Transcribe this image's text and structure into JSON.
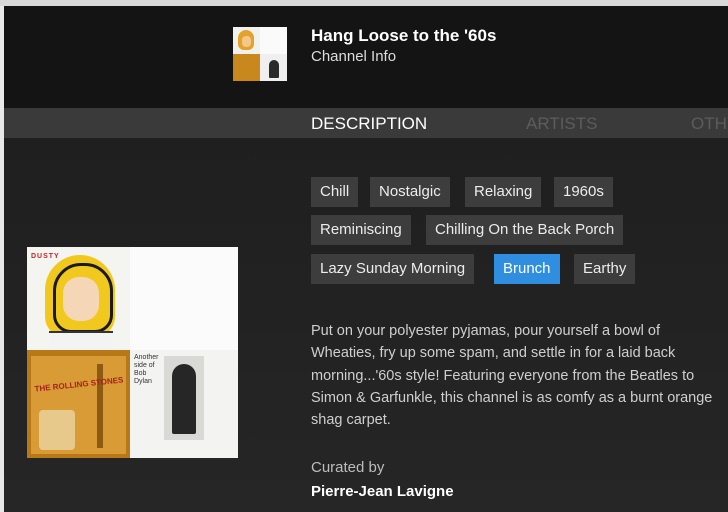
{
  "header": {
    "title": "Hang Loose to the '60s",
    "subtitle": "Channel Info"
  },
  "tabs": [
    {
      "label": "DESCRIPTION",
      "active": true
    },
    {
      "label": "ARTISTS",
      "active": false
    },
    {
      "label": "OTH",
      "active": false
    }
  ],
  "cover_art": {
    "dusty_word": "DUSTY",
    "band_word": "THE ROLLING STONES",
    "dylan_text": "Another side of Bob Dylan"
  },
  "tags": [
    {
      "label": "Chill",
      "selected": false
    },
    {
      "label": "Nostalgic",
      "selected": false
    },
    {
      "label": "Relaxing",
      "selected": false
    },
    {
      "label": "1960s",
      "selected": false
    },
    {
      "label": "Reminiscing",
      "selected": false
    },
    {
      "label": "Chilling On the Back Porch",
      "selected": false
    },
    {
      "label": "Lazy Sunday Morning",
      "selected": false
    },
    {
      "label": "Brunch",
      "selected": true
    },
    {
      "label": "Earthy",
      "selected": false
    }
  ],
  "description": "Put on your polyester pyjamas, pour yourself a bowl of Wheaties, fry up some spam, and settle in for a laid back morning...'60s style! Featuring everyone from the Beatles to Simon & Garfunkle, this channel is as comfy as a burnt orange shag carpet.",
  "curated_label": "Curated by",
  "curator": "Pierre-Jean Lavigne",
  "colors": {
    "accent": "#2f8ee0",
    "tag_bg": "#3d3d3d",
    "background": "#1b1b1b"
  }
}
